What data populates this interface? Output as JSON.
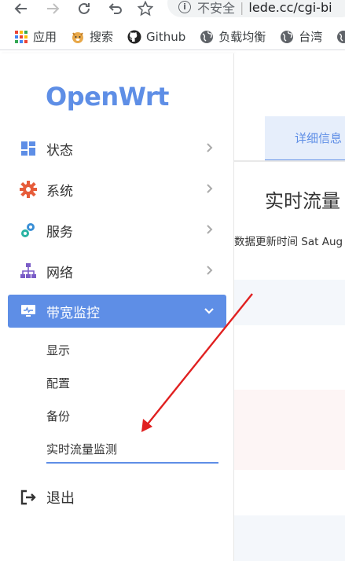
{
  "browser": {
    "security_label": "不安全",
    "url": "lede.cc/cgi-bi",
    "bookmarks": [
      {
        "label": "应用"
      },
      {
        "label": "搜索"
      },
      {
        "label": "Github"
      },
      {
        "label": "负载均衡"
      },
      {
        "label": "台湾"
      }
    ]
  },
  "sidebar": {
    "logo": "OpenWrt",
    "items": [
      {
        "label": "状态"
      },
      {
        "label": "系统"
      },
      {
        "label": "服务"
      },
      {
        "label": "网络"
      },
      {
        "label": "带宽监控"
      }
    ],
    "submenu": [
      {
        "label": "显示"
      },
      {
        "label": "配置"
      },
      {
        "label": "备份"
      },
      {
        "label": "实时流量监测"
      }
    ],
    "logout": "退出"
  },
  "content": {
    "tab_label": "详细信息",
    "title": "实时流量",
    "update_text": "数据更新时间 Sat Aug"
  },
  "colors": {
    "accent": "#5e8ee6",
    "annotation_arrow": "#e02020"
  }
}
